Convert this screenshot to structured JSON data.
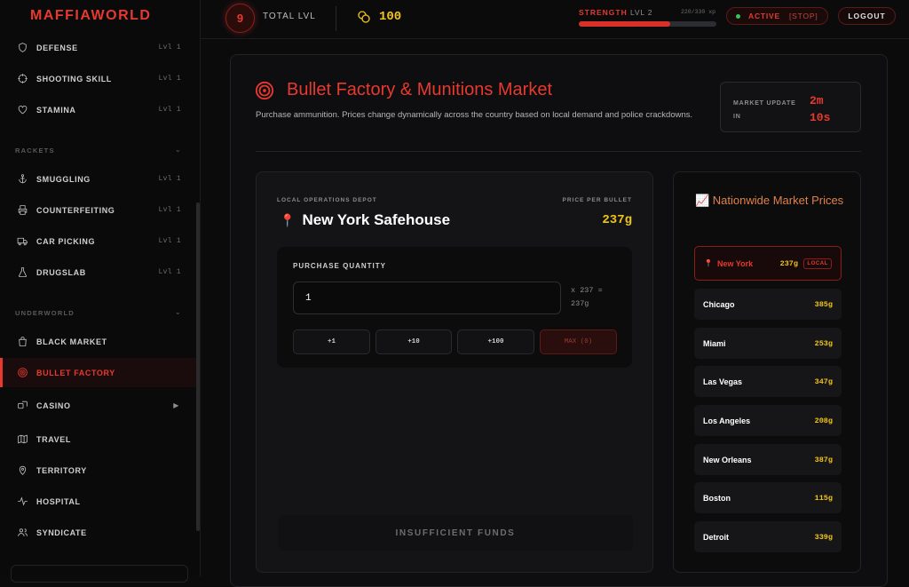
{
  "app": {
    "logo": "MAFFIAWORLD"
  },
  "sidebar": {
    "skills": [
      {
        "label": "DEFENSE",
        "lvl": "Lvl 1",
        "icon": "shield-icon"
      },
      {
        "label": "SHOOTING SKILL",
        "lvl": "Lvl 1",
        "icon": "crosshair-icon"
      },
      {
        "label": "STAMINA",
        "lvl": "Lvl 1",
        "icon": "heart-icon"
      }
    ],
    "rackets_header": "RACKETS",
    "rackets": [
      {
        "label": "SMUGGLING",
        "lvl": "Lvl 1",
        "icon": "anchor-icon"
      },
      {
        "label": "COUNTERFEITING",
        "lvl": "Lvl 1",
        "icon": "printer-icon"
      },
      {
        "label": "CAR PICKING",
        "lvl": "Lvl 1",
        "icon": "truck-icon"
      },
      {
        "label": "DRUGSLAB",
        "lvl": "Lvl 1",
        "icon": "flask-icon"
      }
    ],
    "underworld_header": "UNDERWORLD",
    "underworld": [
      {
        "label": "BLACK MARKET",
        "icon": "shopping-bag-icon"
      },
      {
        "label": "BULLET FACTORY",
        "icon": "target-icon",
        "active": true
      },
      {
        "label": "CASINO",
        "icon": "dice-icon",
        "arrow": "▶"
      },
      {
        "label": "TRAVEL",
        "icon": "map-icon"
      },
      {
        "label": "TERRITORY",
        "icon": "map-pin-icon"
      },
      {
        "label": "HOSPITAL",
        "icon": "activity-icon"
      },
      {
        "label": "SYNDICATE",
        "icon": "users-icon"
      }
    ]
  },
  "topbar": {
    "level": "9",
    "level_label": "TOTAL LVL",
    "coins": "100",
    "strength_label": "STRENGTH",
    "strength_lvl": "LVL 2",
    "strength_xp": "220/330 xp",
    "strength_progress": 0.667,
    "status_label": "ACTIVE",
    "stop_label": "[STOP]",
    "logout_label": "LOGOUT"
  },
  "page": {
    "title": "Bullet Factory & Munitions Market",
    "description": "Purchase ammunition. Prices change dynamically across the country based on local demand and police crackdowns.",
    "market_update_label": "MARKET UPDATE IN",
    "market_update_value": "2m 10s"
  },
  "depot": {
    "label": "LOCAL OPERATIONS DEPOT",
    "name": "New York Safehouse",
    "price_label": "PRICE PER BULLET",
    "price": "237g",
    "qty_label": "PURCHASE QUANTITY",
    "qty_value": "1",
    "qty_calc": "x 237 = 237g",
    "buttons": [
      "+1",
      "+10",
      "+100",
      "MAX (0)"
    ],
    "action_label": "INSUFFICIENT FUNDS"
  },
  "nationwide": {
    "title": "📈 Nationwide Market Prices",
    "local_badge": "LOCAL",
    "cities": [
      {
        "name": "New York",
        "price": "237g",
        "local": true
      },
      {
        "name": "Chicago",
        "price": "385g"
      },
      {
        "name": "Miami",
        "price": "253g"
      },
      {
        "name": "Las Vegas",
        "price": "347g"
      },
      {
        "name": "Los Angeles",
        "price": "208g"
      },
      {
        "name": "New Orleans",
        "price": "387g"
      },
      {
        "name": "Boston",
        "price": "115g"
      },
      {
        "name": "Detroit",
        "price": "339g"
      }
    ]
  },
  "colors": {
    "accent": "#e7392f",
    "gold": "#f0c419",
    "bg": "#0b0b0c"
  }
}
